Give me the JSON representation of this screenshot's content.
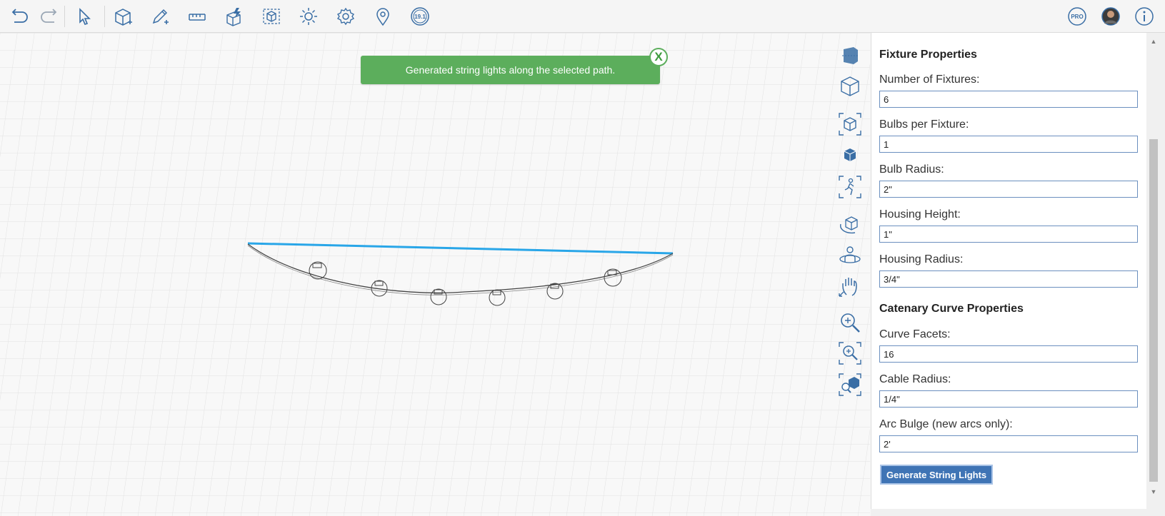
{
  "toast": {
    "message": "Generated string lights along the selected path.",
    "close_label": "X"
  },
  "version_badge": "19.1",
  "pro_badge": "PRO",
  "panel": {
    "fixture_title": "Fixture Properties",
    "fields": [
      {
        "label": "Number of Fixtures:",
        "value": "6"
      },
      {
        "label": "Bulbs per Fixture:",
        "value": "1"
      },
      {
        "label": "Bulb Radius:",
        "value": "2\""
      },
      {
        "label": "Housing Height:",
        "value": "1\""
      },
      {
        "label": "Housing Radius:",
        "value": "3/4\""
      }
    ],
    "curve_title": "Catenary Curve Properties",
    "curve_fields": [
      {
        "label": "Curve Facets:",
        "value": "16"
      },
      {
        "label": "Cable Radius:",
        "value": "1/4\""
      },
      {
        "label": "Arc Bulge (new arcs only):",
        "value": "2'"
      }
    ],
    "generate_label": "Generate String Lights"
  },
  "icons": {
    "toolbar": [
      "undo-icon",
      "redo-icon",
      "select-icon",
      "add-box-icon",
      "draw-icon",
      "measure-icon",
      "quick-tools-icon",
      "add-material-icon",
      "light-icon",
      "settings-icon",
      "location-icon",
      "version-icon"
    ],
    "right": [
      "pro-icon",
      "avatar",
      "info-icon"
    ],
    "side": [
      "view-cube-icon",
      "section-icon",
      "perspective-top-icon",
      "perspective-front-icon",
      "walk-icon",
      "orbit-icon",
      "look-around-icon",
      "pan-icon",
      "zoom-icon",
      "zoom-window-icon",
      "zoom-extents-icon"
    ]
  },
  "colors": {
    "accent": "#3f74b5",
    "toast_bg": "#5cae5c",
    "selection": "#29a6e8",
    "icon": "#3a6ea5"
  }
}
